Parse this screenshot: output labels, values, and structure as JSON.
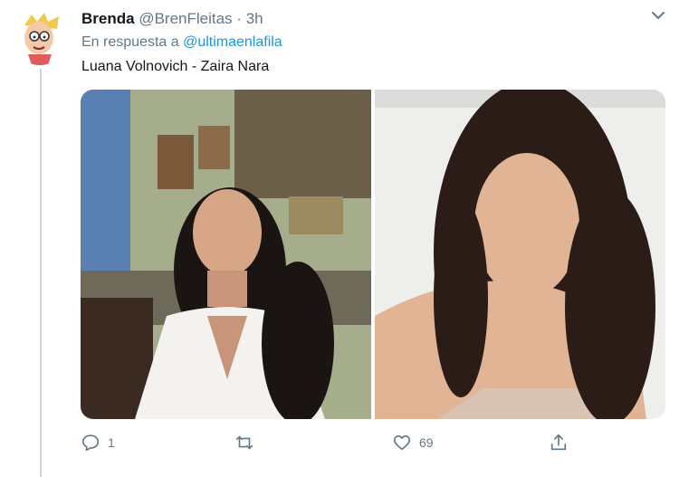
{
  "tweet": {
    "display_name": "Brenda",
    "handle": "@BrenFleitas",
    "separator": "·",
    "time": "3h",
    "reply_prefix": "En respuesta a",
    "reply_to": "@ultimaenlafila",
    "text": "Luana Volnovich - Zaira Nara"
  },
  "media": {
    "left_alt": "",
    "right_alt": ""
  },
  "actions": {
    "reply_count": "1",
    "retweet_count": "",
    "like_count": "69"
  },
  "colors": {
    "muted": "#657786",
    "link": "#1b95e0",
    "thread_line": "#ccd6dd"
  },
  "icons": [
    "reply-icon",
    "retweet-icon",
    "like-icon",
    "share-icon",
    "chevron-down-icon"
  ]
}
